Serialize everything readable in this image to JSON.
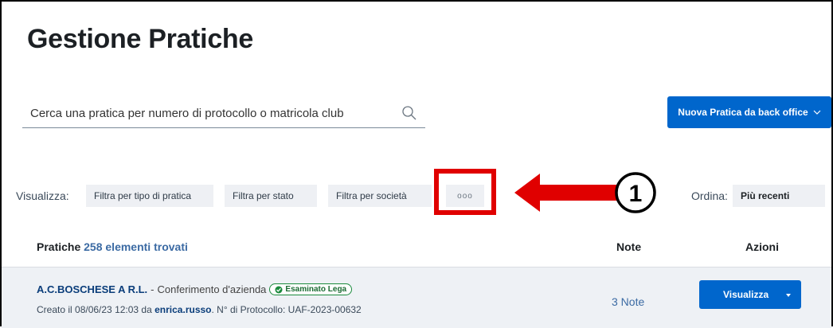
{
  "page": {
    "title": "Gestione Pratiche"
  },
  "search": {
    "placeholder": "Cerca una pratica per numero di protocollo o matricola club",
    "icon": "search-icon"
  },
  "toolbar": {
    "new_button_label": "Nuova Pratica da back office",
    "new_button_icon": "chevron-down-icon"
  },
  "filters": {
    "label": "Visualizza:",
    "items": [
      {
        "label": "Filtra per tipo di pratica"
      },
      {
        "label": "Filtra per stato"
      },
      {
        "label": "Filtra per società"
      }
    ],
    "more_label": "ooo"
  },
  "annotation": {
    "number": "1",
    "color": "#e00000"
  },
  "sort": {
    "label": "Ordina:",
    "value": "Più recenti"
  },
  "table": {
    "header": {
      "pratiche": "Pratiche",
      "count": "258 elementi trovati",
      "note": "Note",
      "azioni": "Azioni"
    },
    "rows": [
      {
        "club": "A.C.BOSCHESE A R.L.",
        "separator": "-",
        "type": "Conferimento d'azienda",
        "badge": "Esaminato Lega",
        "created_prefix": "Creato il 08/06/23 12:03 da",
        "user": "enrica.russo",
        "protocol": ". N° di Protocollo: UAF-2023-00632",
        "note": "3 Note",
        "action_label": "Visualizza"
      }
    ]
  },
  "colors": {
    "primary": "#0066cc",
    "chip_bg": "#eef0f4",
    "badge_green": "#1a8a3c"
  }
}
